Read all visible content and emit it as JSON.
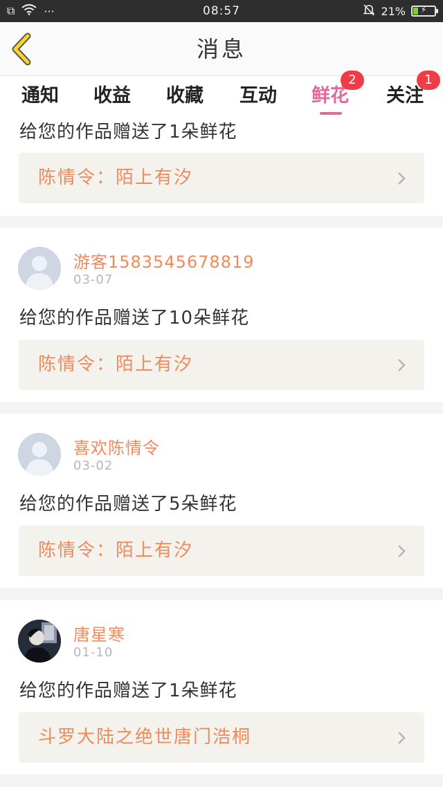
{
  "status_bar": {
    "time": "08:57",
    "battery_percent": "21%",
    "battery_level": 0.21,
    "left_glyph": "⧉",
    "dots": "···",
    "charging": "⚡"
  },
  "nav": {
    "title": "消息"
  },
  "tabs": [
    {
      "label": "通知",
      "badge": ""
    },
    {
      "label": "收益",
      "badge": ""
    },
    {
      "label": "收藏",
      "badge": ""
    },
    {
      "label": "互动",
      "badge": ""
    },
    {
      "label": "鲜花",
      "badge": "2",
      "active": true
    },
    {
      "label": "关注",
      "badge": "1"
    }
  ],
  "feed": [
    {
      "message": "给您的作品赠送了1朵鲜花",
      "work_title": "陈情令：陌上有汐"
    },
    {
      "user": "游客1583545678819",
      "date": "03-07",
      "message": "给您的作品赠送了10朵鲜花",
      "work_title": "陈情令：陌上有汐"
    },
    {
      "user": "喜欢陈情令",
      "date": "03-02",
      "message": "给您的作品赠送了5朵鲜花",
      "work_title": "陈情令：陌上有汐"
    },
    {
      "user": "唐星寒",
      "date": "01-10",
      "message": "给您的作品赠送了1朵鲜花",
      "work_title": "斗罗大陆之绝世唐门浩桐"
    }
  ],
  "colors": {
    "accent": "#e06a99",
    "name_orange": "#f08a5d",
    "badge_red": "#f03c46",
    "back_arrow": "#f5d33a"
  }
}
